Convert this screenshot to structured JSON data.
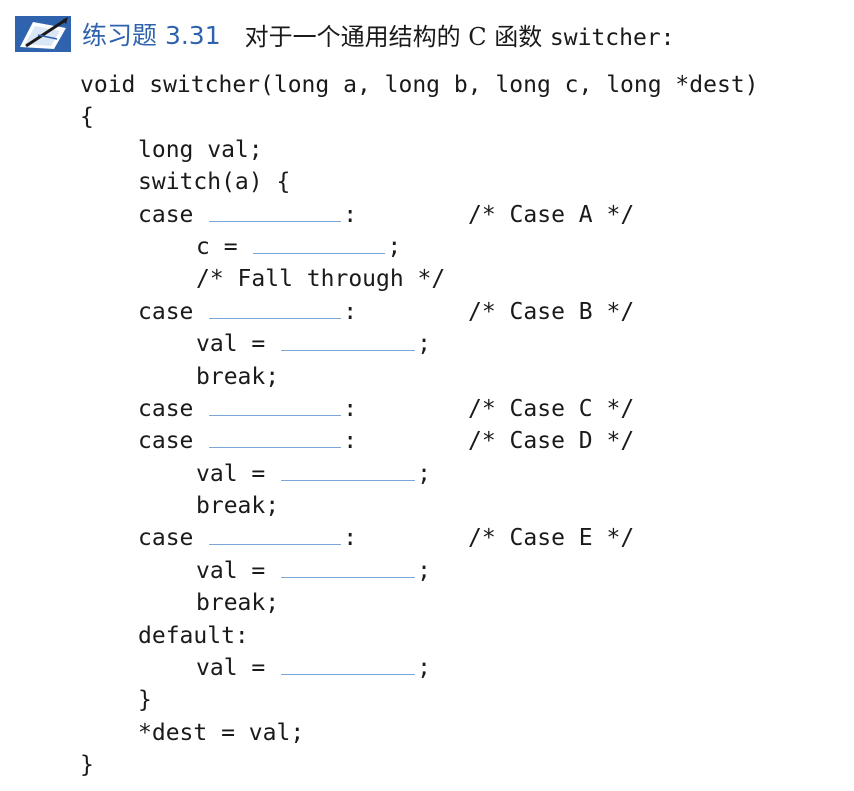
{
  "header": {
    "exercise_tag": "练习题 3.31",
    "title_text": "对于一个通用结构的 C 函数 ",
    "title_code": "switcher:"
  },
  "code": {
    "signature": "void switcher(long a, long b, long c, long *dest)",
    "open_brace": "{",
    "decl": "long val;",
    "switch_open": "switch(a) {",
    "case_keyword": "case",
    "colon": ":",
    "semicolon": ";",
    "assign_c": "c =",
    "assign_val": "val =",
    "fall_through": "/* Fall through */",
    "break_stmt": "break;",
    "default_label": "default:",
    "switch_close": "}",
    "dest_assign": "*dest = val;",
    "close_brace": "}",
    "comments": {
      "case_a": "/* Case A */",
      "case_b": "/* Case B */",
      "case_c": "/* Case C */",
      "case_d": "/* Case D */",
      "case_e": "/* Case E */"
    }
  },
  "colors": {
    "exercise_blue": "#2f63ad",
    "blank_underline": "#7aa6d8",
    "text": "#1a1a1a"
  },
  "icons": {
    "header_icon": "pencil-and-paper-icon"
  }
}
